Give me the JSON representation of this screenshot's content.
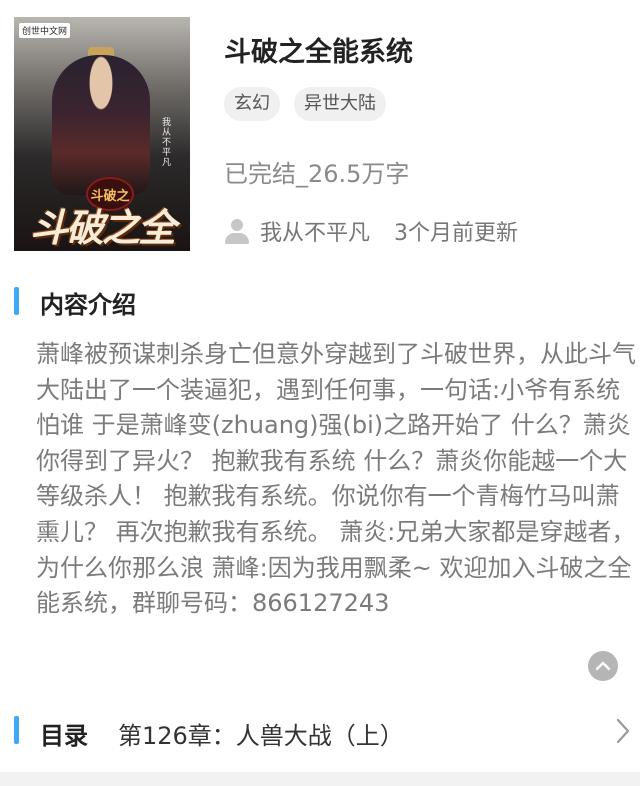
{
  "book": {
    "cover": {
      "badge": "创世中文网",
      "title_art": "斗破之全能系统",
      "seal": "斗破之",
      "author_art": "我从不平凡"
    },
    "title": "斗破之全能系统",
    "tags": [
      "玄幻",
      "异世大陆"
    ],
    "status": "已完结_26.5万字",
    "author": "我从不平凡",
    "updated": "3个月前更新"
  },
  "intro": {
    "heading": "内容介绍",
    "text": "萧峰被预谋刺杀身亡但意外穿越到了斗破世界，从此斗气大陆出了一个装逼犯，遇到任何事，一句话:小爷有系统怕谁 于是萧峰变(zhuang)强(bi)之路开始了 什么？萧炎你得到了异火？ 抱歉我有系统 什么？萧炎你能越一个大等级杀人！ 抱歉我有系统。你说你有一个青梅竹马叫萧熏儿？ 再次抱歉我有系统。 萧炎:兄弟大家都是穿越者，为什么你那么浪 萧峰:因为我用飘柔~ 欢迎加入斗破之全能系统，群聊号码：866127243"
  },
  "toc": {
    "label": "目录",
    "latest_chapter": "第126章：人兽大战（上）"
  },
  "colors": {
    "accent": "#3fa9f5",
    "muted_text": "#7b7b7b",
    "tag_bg": "#f0f0f0"
  },
  "icons": {
    "user": "user-icon",
    "collapse": "chevron-up-icon",
    "toc_arrow": "chevron-right-icon"
  }
}
